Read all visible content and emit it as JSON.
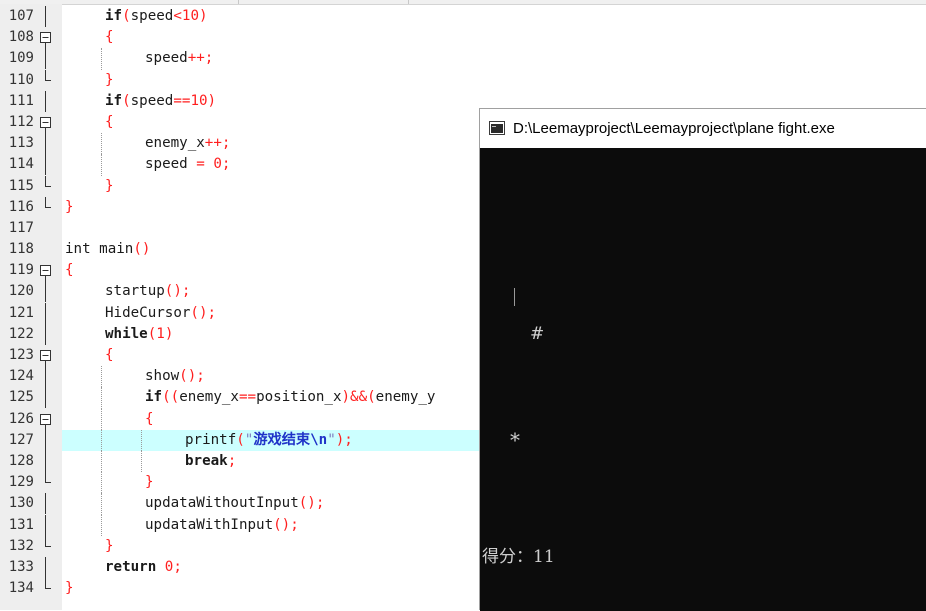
{
  "editor": {
    "lines": [
      {
        "num": "107",
        "fold": "line",
        "indent": 1,
        "current": false,
        "tokens": [
          {
            "t": "if",
            "c": "kw"
          },
          {
            "t": "(",
            "c": "op"
          },
          {
            "t": "speed",
            "c": "id"
          },
          {
            "t": "<",
            "c": "op"
          },
          {
            "t": "10",
            "c": "num"
          },
          {
            "t": ")",
            "c": "op"
          }
        ]
      },
      {
        "num": "108",
        "fold": "minus",
        "indent": 1,
        "current": false,
        "tokens": [
          {
            "t": "{",
            "c": "op"
          }
        ]
      },
      {
        "num": "109",
        "fold": "line",
        "indent": 2,
        "current": false,
        "tokens": [
          {
            "t": "speed",
            "c": "id"
          },
          {
            "t": "++;",
            "c": "op"
          }
        ]
      },
      {
        "num": "110",
        "fold": "end",
        "indent": 1,
        "current": false,
        "tokens": [
          {
            "t": "}",
            "c": "op"
          }
        ]
      },
      {
        "num": "111",
        "fold": "line",
        "indent": 1,
        "current": false,
        "tokens": [
          {
            "t": "if",
            "c": "kw"
          },
          {
            "t": "(",
            "c": "op"
          },
          {
            "t": "speed",
            "c": "id"
          },
          {
            "t": "==",
            "c": "op"
          },
          {
            "t": "10",
            "c": "num"
          },
          {
            "t": ")",
            "c": "op"
          }
        ]
      },
      {
        "num": "112",
        "fold": "minus",
        "indent": 1,
        "current": false,
        "tokens": [
          {
            "t": "{",
            "c": "op"
          }
        ]
      },
      {
        "num": "113",
        "fold": "line",
        "indent": 2,
        "current": false,
        "tokens": [
          {
            "t": "enemy_x",
            "c": "id"
          },
          {
            "t": "++;",
            "c": "op"
          }
        ]
      },
      {
        "num": "114",
        "fold": "line",
        "indent": 2,
        "current": false,
        "tokens": [
          {
            "t": "speed ",
            "c": "id"
          },
          {
            "t": "=",
            "c": "op"
          },
          {
            "t": " ",
            "c": "id"
          },
          {
            "t": "0",
            "c": "num"
          },
          {
            "t": ";",
            "c": "op"
          }
        ]
      },
      {
        "num": "115",
        "fold": "end",
        "indent": 1,
        "current": false,
        "tokens": [
          {
            "t": "}",
            "c": "op"
          }
        ]
      },
      {
        "num": "116",
        "fold": "end",
        "indent": 0,
        "current": false,
        "tokens": [
          {
            "t": "}",
            "c": "op"
          }
        ]
      },
      {
        "num": "117",
        "fold": "none",
        "indent": 0,
        "current": false,
        "tokens": []
      },
      {
        "num": "118",
        "fold": "none",
        "indent": 0,
        "current": false,
        "tokens": [
          {
            "t": "int",
            "c": "kwt"
          },
          {
            "t": " main",
            "c": "id"
          },
          {
            "t": "()",
            "c": "op"
          }
        ]
      },
      {
        "num": "119",
        "fold": "minus",
        "indent": 0,
        "current": false,
        "tokens": [
          {
            "t": "{",
            "c": "op"
          }
        ]
      },
      {
        "num": "120",
        "fold": "line",
        "indent": 1,
        "current": false,
        "tokens": [
          {
            "t": "startup",
            "c": "id"
          },
          {
            "t": "();",
            "c": "op"
          }
        ]
      },
      {
        "num": "121",
        "fold": "line",
        "indent": 1,
        "current": false,
        "tokens": [
          {
            "t": "HideCursor",
            "c": "id"
          },
          {
            "t": "();",
            "c": "op"
          }
        ]
      },
      {
        "num": "122",
        "fold": "line",
        "indent": 1,
        "current": false,
        "tokens": [
          {
            "t": "while",
            "c": "kw"
          },
          {
            "t": "(",
            "c": "op"
          },
          {
            "t": "1",
            "c": "num"
          },
          {
            "t": ")",
            "c": "op"
          }
        ]
      },
      {
        "num": "123",
        "fold": "minus",
        "indent": 1,
        "current": false,
        "tokens": [
          {
            "t": "{",
            "c": "op"
          }
        ]
      },
      {
        "num": "124",
        "fold": "line",
        "indent": 2,
        "current": false,
        "tokens": [
          {
            "t": "show",
            "c": "id"
          },
          {
            "t": "();",
            "c": "op"
          }
        ]
      },
      {
        "num": "125",
        "fold": "line",
        "indent": 2,
        "current": false,
        "tokens": [
          {
            "t": "if",
            "c": "kw"
          },
          {
            "t": "((",
            "c": "op"
          },
          {
            "t": "enemy_x",
            "c": "id"
          },
          {
            "t": "==",
            "c": "op"
          },
          {
            "t": "position_x",
            "c": "id"
          },
          {
            "t": ")&&(",
            "c": "op"
          },
          {
            "t": "enemy_y",
            "c": "id"
          }
        ]
      },
      {
        "num": "126",
        "fold": "minus",
        "indent": 2,
        "current": false,
        "tokens": [
          {
            "t": "{",
            "c": "op"
          }
        ]
      },
      {
        "num": "127",
        "fold": "line",
        "indent": 3,
        "current": true,
        "tokens": [
          {
            "t": "printf",
            "c": "id"
          },
          {
            "t": "(",
            "c": "op"
          },
          {
            "t": "\"",
            "c": "str"
          },
          {
            "t": "游戏结束\\n",
            "c": "strb"
          },
          {
            "t": "\"",
            "c": "str"
          },
          {
            "t": ");",
            "c": "op"
          }
        ]
      },
      {
        "num": "128",
        "fold": "line",
        "indent": 3,
        "current": false,
        "tokens": [
          {
            "t": "break",
            "c": "kw"
          },
          {
            "t": ";",
            "c": "op"
          }
        ]
      },
      {
        "num": "129",
        "fold": "end",
        "indent": 2,
        "current": false,
        "tokens": [
          {
            "t": "}",
            "c": "op"
          }
        ]
      },
      {
        "num": "130",
        "fold": "line",
        "indent": 2,
        "current": false,
        "tokens": [
          {
            "t": "updataWithoutInput",
            "c": "id"
          },
          {
            "t": "();",
            "c": "op"
          }
        ]
      },
      {
        "num": "131",
        "fold": "line",
        "indent": 2,
        "current": false,
        "tokens": [
          {
            "t": "updataWithInput",
            "c": "id"
          },
          {
            "t": "();",
            "c": "op"
          }
        ]
      },
      {
        "num": "132",
        "fold": "end",
        "indent": 1,
        "current": false,
        "tokens": [
          {
            "t": "}",
            "c": "op"
          }
        ]
      },
      {
        "num": "133",
        "fold": "line",
        "indent": 1,
        "current": false,
        "tokens": [
          {
            "t": "return",
            "c": "kw"
          },
          {
            "t": " ",
            "c": "id"
          },
          {
            "t": "0",
            "c": "num"
          },
          {
            "t": ";",
            "c": "op"
          }
        ]
      },
      {
        "num": "134",
        "fold": "end",
        "indent": 0,
        "current": false,
        "tokens": [
          {
            "t": "}",
            "c": "op"
          }
        ]
      }
    ]
  },
  "console": {
    "title": "D:\\Leemayproject\\Leemayproject\\plane fight.exe",
    "enemy_char": "#",
    "plane_char": "*",
    "score_text": "得分：11"
  },
  "colors": {
    "keyword": "#1a1a1a",
    "operator": "#ff1e1e",
    "string": "#1f32c8",
    "current_line": "#ccffff",
    "console_bg": "#0c0c0c"
  }
}
